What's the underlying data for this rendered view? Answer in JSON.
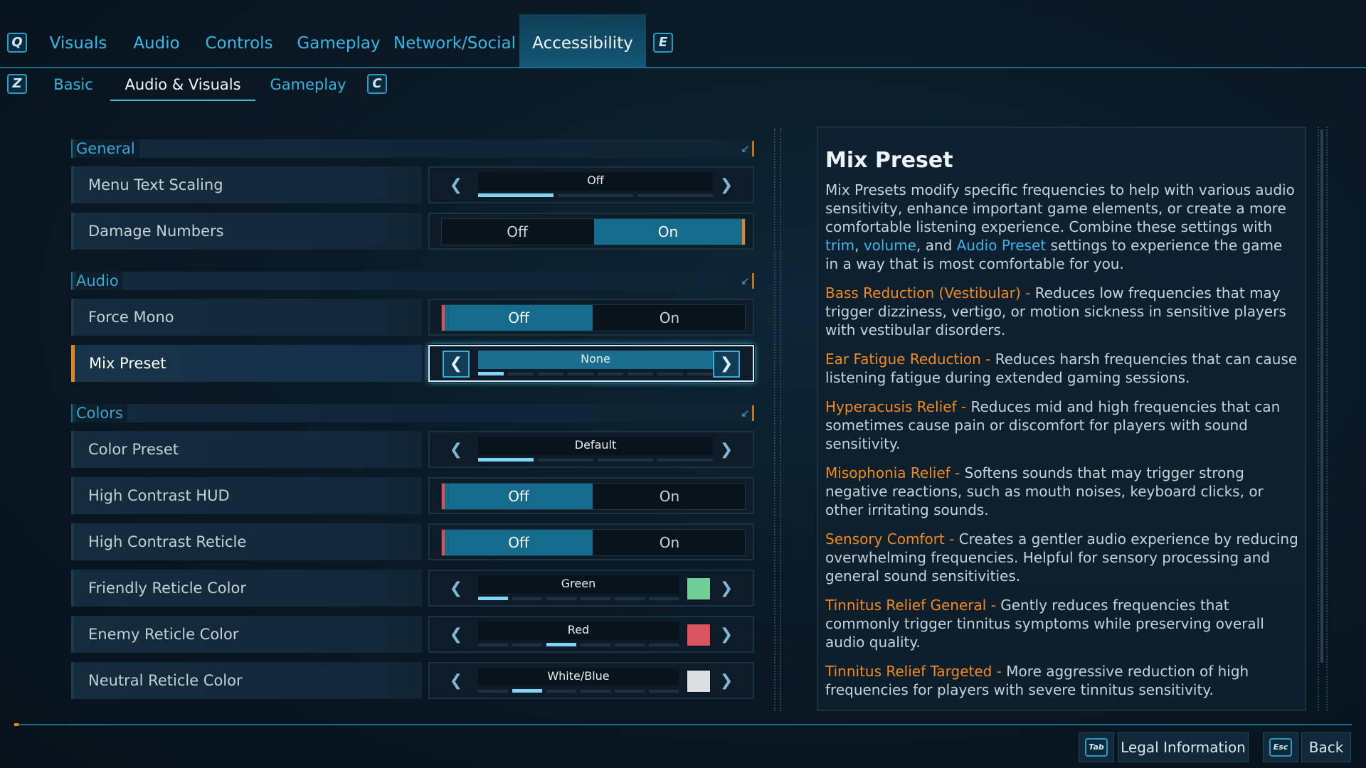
{
  "top_tabs": {
    "left_key": "Q",
    "right_key": "E",
    "items": [
      "Visuals",
      "Audio",
      "Controls",
      "Gameplay",
      "Network/Social",
      "Accessibility"
    ],
    "active": "Accessibility"
  },
  "sub_tabs": {
    "left_key": "Z",
    "right_key": "C",
    "items": [
      "Basic",
      "Audio & Visuals",
      "Gameplay"
    ],
    "active": "Audio & Visuals"
  },
  "sections": {
    "general": "General",
    "audio": "Audio",
    "colors": "Colors"
  },
  "settings": {
    "menu_text_scaling": {
      "label": "Menu Text Scaling",
      "value": "Off",
      "level": 1,
      "steps": 3
    },
    "damage_numbers": {
      "label": "Damage Numbers",
      "off": "Off",
      "on": "On",
      "selected": "On"
    },
    "force_mono": {
      "label": "Force Mono",
      "off": "Off",
      "on": "On",
      "selected": "Off"
    },
    "mix_preset": {
      "label": "Mix Preset",
      "value": "None",
      "level": 1,
      "steps": 8
    },
    "color_preset": {
      "label": "Color Preset",
      "value": "Default",
      "level": 1,
      "steps": 4
    },
    "high_contrast_hud": {
      "label": "High Contrast HUD",
      "off": "Off",
      "on": "On",
      "selected": "Off"
    },
    "high_contrast_reticle": {
      "label": "High Contrast Reticle",
      "off": "Off",
      "on": "On",
      "selected": "Off"
    },
    "friendly_reticle_color": {
      "label": "Friendly Reticle Color",
      "value": "Green",
      "level": 1,
      "steps": 6,
      "swatch": "#6fcf97"
    },
    "enemy_reticle_color": {
      "label": "Enemy Reticle Color",
      "value": "Red",
      "level": 3,
      "steps": 6,
      "swatch": "#d9545f"
    },
    "neutral_reticle_color": {
      "label": "Neutral Reticle Color",
      "value": "White/Blue",
      "level": 2,
      "steps": 6,
      "swatch": "#dcdfe2"
    }
  },
  "description": {
    "title": "Mix Preset",
    "intro_1": "Mix Presets modify specific frequencies to help with various audio sensitivity, enhance important game elements, or create a more comfortable listening experience. Combine these settings with ",
    "link_trim": "trim",
    "sep_1": ", ",
    "link_volume": "volume",
    "sep_2": ", and ",
    "link_audio_preset": "Audio Preset",
    "intro_2": " settings to experience the game in a way that is most comfortable for you.",
    "entries": [
      {
        "term": "Bass Reduction (Vestibular) - ",
        "text": "Reduces low frequencies that may trigger dizziness, vertigo, or motion sickness in sensitive players with vestibular disorders."
      },
      {
        "term": "Ear Fatigue Reduction - ",
        "text": "Reduces harsh frequencies that can cause listening fatigue during extended gaming sessions."
      },
      {
        "term": "Hyperacusis Relief - ",
        "text": "Reduces mid and high frequencies that can sometimes cause pain or discomfort for players with sound sensitivity."
      },
      {
        "term": "Misophonia Relief - ",
        "text": "Softens sounds that may trigger strong negative reactions, such as mouth noises, keyboard clicks, or other irritating sounds."
      },
      {
        "term": "Sensory Comfort - ",
        "text": "Creates a gentler audio experience by reducing overwhelming frequencies. Helpful for sensory processing and general sound sensitivities."
      },
      {
        "term": "Tinnitus Relief General - ",
        "text": "Gently reduces frequencies that commonly trigger tinnitus symptoms while preserving overall audio quality."
      },
      {
        "term": "Tinnitus Relief Targeted - ",
        "text": "More aggressive reduction of high frequencies for players with severe tinnitus sensitivity."
      }
    ]
  },
  "footer": {
    "legal_key": "Tab",
    "legal_label": "Legal Information",
    "back_key": "Esc",
    "back_label": "Back"
  },
  "icons": {
    "arrow_left": "chevron-left-icon",
    "arrow_right": "chevron-right-icon",
    "collapse": "collapse-corner-icon"
  }
}
